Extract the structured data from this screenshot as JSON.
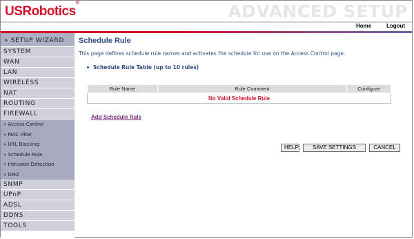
{
  "header": {
    "logo_text": "USRobotics",
    "logo_mark": "®",
    "watermark": "ADVANCED SETUP",
    "nav": {
      "home": "Home",
      "logout": "Logout"
    }
  },
  "sidebar": {
    "wizard": "» SETUP WIZARD",
    "items_top": [
      "SYSTEM",
      "WAN",
      "LAN",
      "WIRELESS",
      "NAT",
      "ROUTING",
      "FIREWALL"
    ],
    "firewall_sub": [
      "» Access Control",
      "» MAC Filter",
      "» URL Blocking",
      "» Schedule Rule",
      "» Intrusion Detection",
      "» DMZ"
    ],
    "items_bottom": [
      "SNMP",
      "UPnP",
      "ADSL",
      "DDNS",
      "TOOLS"
    ]
  },
  "main": {
    "title": "Schedule Rule",
    "description": "This page defines schedule rule names and activates the schedule for use on the Access Control page.",
    "table_heading": "Schedule Rule Table (up to 10 rules)",
    "table": {
      "columns": [
        "Rule Name",
        "Rule Comment",
        "Configure"
      ],
      "empty_message": "No Valid Schedule Rule"
    },
    "add_link": "Add Schedule Rule",
    "buttons": {
      "help": "HELP",
      "save": "SAVE SETTINGS",
      "cancel": "CANCEL"
    }
  },
  "colors": {
    "brand_red": "#d4102a",
    "heading_blue": "#2f4c86",
    "sidebar_bg": "#cfd0dc",
    "sidebar_sub_bg": "#a8aac0"
  }
}
